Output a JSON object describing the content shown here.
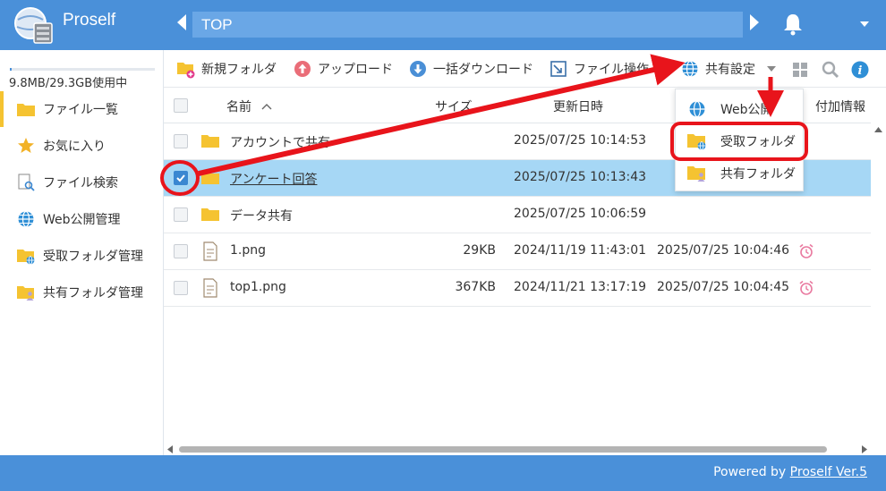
{
  "app": {
    "name": "Proself"
  },
  "header": {
    "path": "TOP"
  },
  "sidebar": {
    "usage": "9.8MB/29.3GB使用中",
    "usage_fraction": 0.0003,
    "items": [
      {
        "label": "ファイル一覧",
        "icon": "folder-icon"
      },
      {
        "label": "お気に入り",
        "icon": "star-icon"
      },
      {
        "label": "ファイル検索",
        "icon": "search-file-icon"
      },
      {
        "label": "Web公開管理",
        "icon": "globe-icon"
      },
      {
        "label": "受取フォルダ管理",
        "icon": "receive-folder-icon"
      },
      {
        "label": "共有フォルダ管理",
        "icon": "shared-folder-icon"
      }
    ]
  },
  "toolbar": {
    "new_folder": "新規フォルダ",
    "upload": "アップロード",
    "bulk_download": "一括ダウンロード",
    "file_ops": "ファイル操作",
    "share_settings": "共有設定"
  },
  "table": {
    "headers": {
      "name": "名前",
      "size": "サイズ",
      "updated": "更新日時",
      "extra": "付加情報"
    },
    "rows": [
      {
        "name": "アカウントで共有",
        "size": "",
        "updated": "2025/07/25 10:14:53",
        "extra": "",
        "type": "folder",
        "checked": false,
        "selected": false
      },
      {
        "name": "アンケート回答",
        "size": "",
        "updated": "2025/07/25 10:13:43",
        "extra": "",
        "type": "folder",
        "checked": true,
        "selected": true
      },
      {
        "name": "データ共有",
        "size": "",
        "updated": "2025/07/25 10:06:59",
        "extra": "",
        "type": "folder",
        "checked": false,
        "selected": false
      },
      {
        "name": "1.png",
        "size": "29KB",
        "updated": "2024/11/19 11:43:01",
        "extra": "2025/07/25 10:04:46",
        "type": "file",
        "checked": false,
        "selected": false
      },
      {
        "name": "top1.png",
        "size": "367KB",
        "updated": "2024/11/21 13:17:19",
        "extra": "2025/07/25 10:04:45",
        "type": "file",
        "checked": false,
        "selected": false
      }
    ]
  },
  "dropdown": {
    "items": [
      {
        "label": "Web公開",
        "icon": "globe-icon"
      },
      {
        "label": "受取フォルダ",
        "icon": "receive-folder-icon"
      },
      {
        "label": "共有フォルダ",
        "icon": "shared-folder-icon"
      }
    ]
  },
  "footer": {
    "prefix": "Powered by ",
    "link": "Proself Ver.5"
  },
  "colors": {
    "header": "#4a90d9",
    "selected_row": "#a6d7f5",
    "highlight": "#e8141b",
    "folder": "#f5c331"
  }
}
